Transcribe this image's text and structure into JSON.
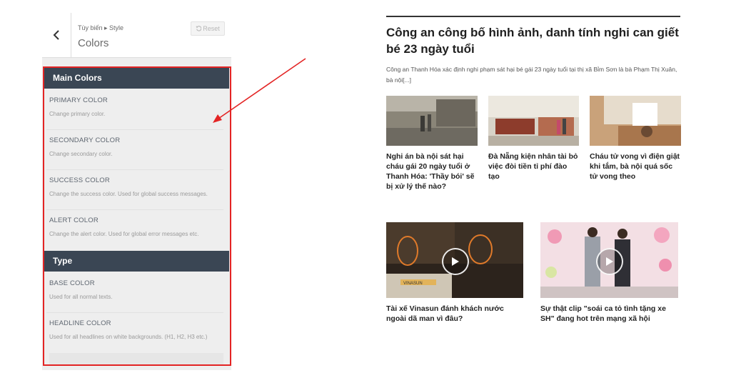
{
  "customizer": {
    "breadcrumb": "Tùy biến ▸ Style",
    "title": "Colors",
    "reset_label": "Reset",
    "sections": [
      {
        "label": "Main Colors",
        "options": [
          {
            "title": "PRIMARY COLOR",
            "desc": "Change primary color."
          },
          {
            "title": "SECONDARY COLOR",
            "desc": "Change secondary color."
          },
          {
            "title": "SUCCESS COLOR",
            "desc": "Change the success color. Used for global success messages."
          },
          {
            "title": "ALERT COLOR",
            "desc": "Change the alert color. Used for global error messages etc."
          }
        ]
      },
      {
        "label": "Type",
        "options": [
          {
            "title": "BASE COLOR",
            "desc": "Used for all normal texts."
          },
          {
            "title": "HEADLINE COLOR",
            "desc": "Used for all headlines on white backgrounds. (H1, H2, H3 etc.)"
          }
        ]
      }
    ],
    "highlight_color": "#e32424",
    "section_bar_color": "#3a4654"
  },
  "article": {
    "title": "Công an công bố hình ảnh, danh tính nghi can giết bé 23 ngày tuổi",
    "excerpt": "Công an Thanh Hóa xác định nghi phạm sát hại bé gái 23 ngày tuổi tại thị xã Bỉm Sơn là bà Phạm Thị Xuân, bà nội[...]"
  },
  "related": [
    {
      "title": "Nghi án bà nội sát hại cháu gái 20 ngày tuổi ở Thanh Hóa: 'Thầy bói' sẽ bị xử lý thế nào?"
    },
    {
      "title": "Đà Nẵng kiện nhân tài bỏ việc đòi tiền tỉ phí đào tạo"
    },
    {
      "title": "Cháu tử vong vì điện giật khi tắm, bà nội quá sốc tử vong theo"
    }
  ],
  "videos": [
    {
      "title": "Tài xế Vinasun đánh khách nước ngoài dã man vì đâu?",
      "watermark": "VINASUN",
      "icon": "play-icon"
    },
    {
      "title": "Sự thật clip \"soái ca tỏ tình tặng xe SH\" đang hot trên mạng xã hội",
      "icon": "play-icon"
    }
  ]
}
